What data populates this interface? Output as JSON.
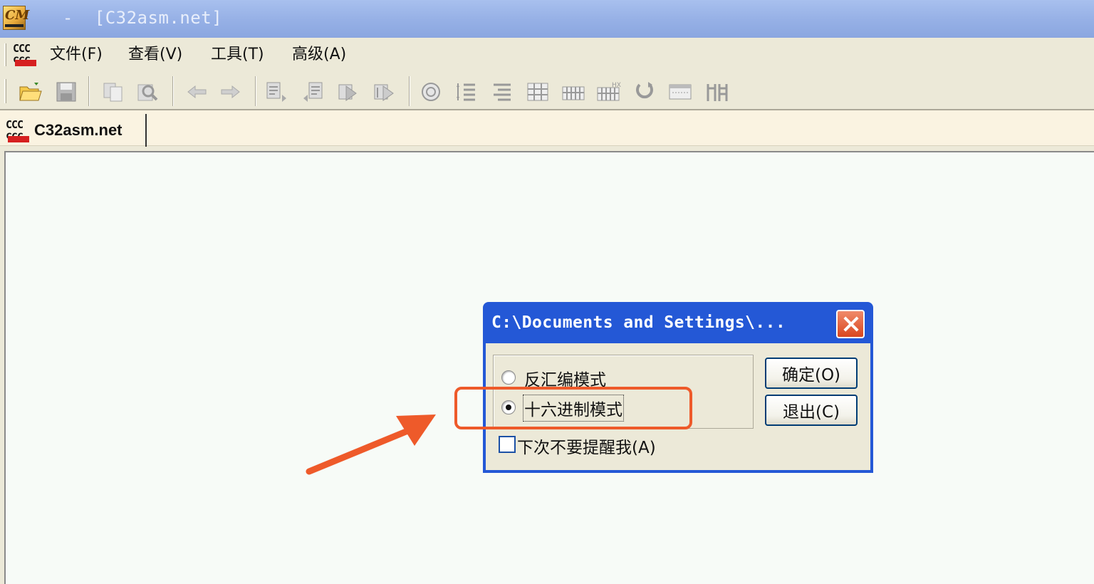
{
  "window": {
    "title": "  -  [C32asm.net]",
    "app_icon": "cm-app-icon"
  },
  "menubar": {
    "logo": "ccc-logo-icon",
    "items": [
      {
        "label": "文件(F)"
      },
      {
        "label": "查看(V)"
      },
      {
        "label": "工具(T)"
      },
      {
        "label": "高级(A)"
      }
    ]
  },
  "toolbar": {
    "icons": [
      "open-folder-icon",
      "save-icon",
      "copy-icon",
      "find-icon",
      "back-arrow-icon",
      "forward-arrow-icon",
      "goto-icon",
      "return-icon",
      "jump-icon",
      "step-icon",
      "target-icon",
      "list-align-icon",
      "list-indent-icon",
      "grid-icon",
      "table-icon",
      "hex-grid-icon",
      "refresh-icon",
      "window-icon",
      "columns-icon"
    ]
  },
  "tab": {
    "label": "C32asm.net",
    "icon": "ccc-logo-icon"
  },
  "dialog": {
    "title": "C:\\Documents and Settings\\...",
    "options": [
      {
        "label": "反汇编模式",
        "checked": false
      },
      {
        "label": "十六进制模式",
        "checked": true
      }
    ],
    "checkbox": {
      "label": "下次不要提醒我(A)",
      "checked": false
    },
    "ok_button": "确定(O)",
    "exit_button": "退出(C)"
  },
  "colors": {
    "annotation": "#ee5a2a",
    "dialog_title_bar": "#2458d6",
    "close_button": "#d9461f"
  }
}
